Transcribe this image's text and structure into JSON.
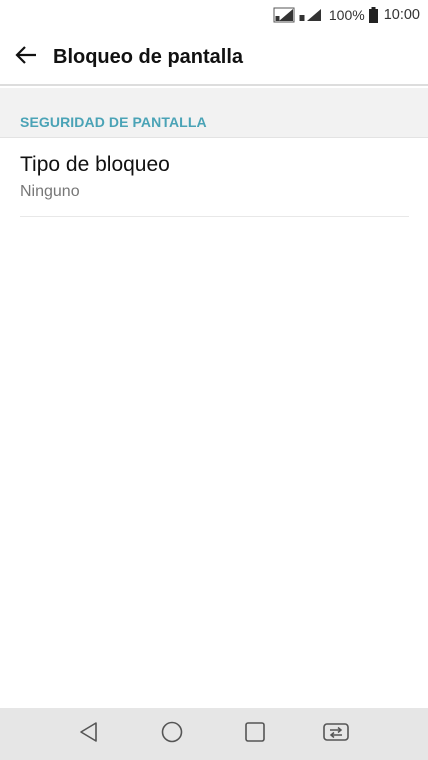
{
  "status_bar": {
    "battery_percent": "100%",
    "time": "10:00",
    "icons": [
      "sim1-signal-icon",
      "sim2-signal-icon",
      "battery-icon"
    ]
  },
  "app_bar": {
    "back_icon": "arrow-left-icon",
    "title": "Bloqueo de pantalla"
  },
  "section": {
    "header": "SEGURIDAD DE PANTALLA",
    "items": [
      {
        "title": "Tipo de bloqueo",
        "subtitle": "Ninguno"
      }
    ]
  },
  "nav_bar": {
    "buttons": [
      "back-triangle-icon",
      "home-circle-icon",
      "recents-square-icon",
      "dual-window-icon"
    ]
  },
  "colors": {
    "accent": "#4aa3b6",
    "section_background": "#f2f2f2",
    "nav_background": "#e6e6e6"
  }
}
